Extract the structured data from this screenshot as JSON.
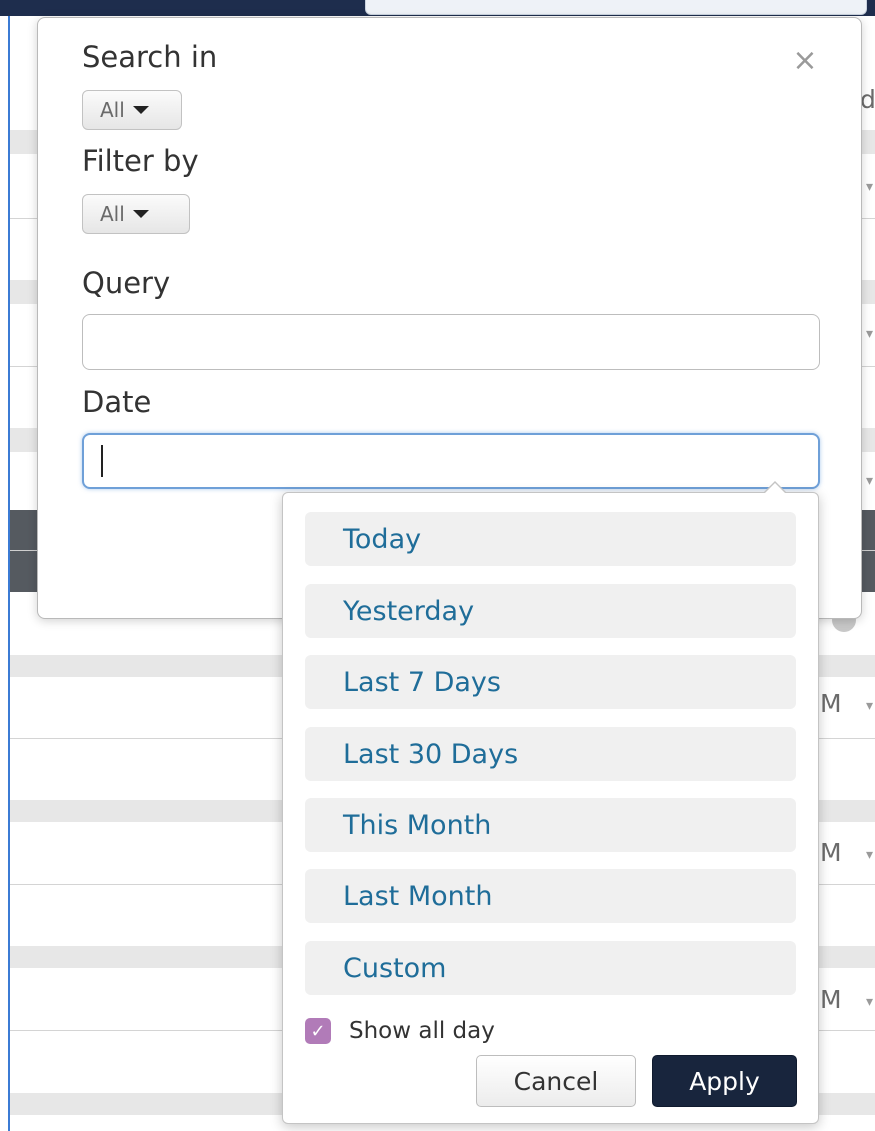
{
  "background": {
    "row_fragments": [
      "d",
      "M",
      "M",
      "M"
    ]
  },
  "modal": {
    "close_glyph": "×",
    "search_in": {
      "label": "Search in",
      "selected": "All"
    },
    "filter_by": {
      "label": "Filter by",
      "selected": "All"
    },
    "query": {
      "label": "Query",
      "value": "",
      "placeholder": ""
    },
    "date": {
      "label": "Date",
      "value": "",
      "placeholder": ""
    }
  },
  "date_picker": {
    "ranges": [
      "Today",
      "Yesterday",
      "Last 7 Days",
      "Last 30 Days",
      "This Month",
      "Last Month",
      "Custom"
    ],
    "show_all_day": {
      "label": "Show all day",
      "checked": true
    },
    "cancel_label": "Cancel",
    "apply_label": "Apply"
  },
  "colors": {
    "accent_link": "#1f6d99",
    "apply_button": "#18253d",
    "checkbox": "#b17bb8",
    "focus_border": "#6fa0d8"
  }
}
